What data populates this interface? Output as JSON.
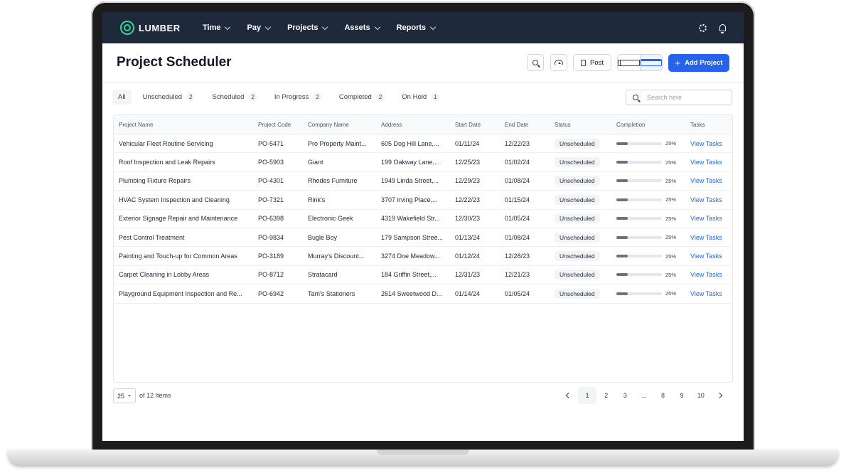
{
  "brand": {
    "name": "LUMBER",
    "accent": "#34d399"
  },
  "nav": {
    "items": [
      "Time",
      "Pay",
      "Projects",
      "Assets",
      "Reports"
    ]
  },
  "header": {
    "title": "Project Scheduler",
    "post_label": "Post",
    "add_label": "Add Project"
  },
  "tabs": [
    {
      "label": "All",
      "count": ""
    },
    {
      "label": "Unscheduled",
      "count": "2"
    },
    {
      "label": "Scheduled",
      "count": "2"
    },
    {
      "label": "In Progress",
      "count": "2"
    },
    {
      "label": "Completed",
      "count": "2"
    },
    {
      "label": "On Hold",
      "count": "1"
    }
  ],
  "search": {
    "placeholder": "Search here"
  },
  "table": {
    "columns": [
      "Project Name",
      "Project Code",
      "Company Name",
      "Address",
      "Start Date",
      "End Date",
      "Status",
      "Completion",
      "Tasks"
    ],
    "rows": [
      [
        "Vehicular Fleet Routine Servicing",
        "PO-5471",
        "Pro Property Maint...",
        "605 Dog Hill Lane,...",
        "01/11/24",
        "12/22/23",
        "Unscheduled",
        "25%",
        "View Tasks"
      ],
      [
        "Roof Inspection and Leak Repairs",
        "PO-5903",
        "Giant",
        "199 Oakway Lane,...",
        "12/25/23",
        "01/02/24",
        "Unscheduled",
        "25%",
        "View Tasks"
      ],
      [
        "Plumbing Fixture Repairs",
        "PO-4301",
        "Rhodes Furniture",
        "1949 Linda Street,...",
        "12/29/23",
        "01/08/24",
        "Unscheduled",
        "25%",
        "View Tasks"
      ],
      [
        "HVAC System Inspection and Cleaning",
        "PO-7321",
        "Rink's",
        "3707 Irving Place,...",
        "12/22/23",
        "01/15/24",
        "Unscheduled",
        "25%",
        "View Tasks"
      ],
      [
        "Exterior Signage Repair and Maintenance",
        "PO-6398",
        "Electronic Geek",
        "4319 Wakefield Str...",
        "12/30/23",
        "01/05/24",
        "Unscheduled",
        "25%",
        "View Tasks"
      ],
      [
        "Pest Control Treatment",
        "PO-9834",
        "Bugle Boy",
        "179 Sampson Stree...",
        "01/13/24",
        "01/08/24",
        "Unscheduled",
        "25%",
        "View Tasks"
      ],
      [
        "Painting and Touch-up for Common Areas",
        "PO-3189",
        "Murray's Discount...",
        "3274 Doe Meadow...",
        "01/12/24",
        "12/28/23",
        "Unscheduled",
        "25%",
        "View Tasks"
      ],
      [
        "Carpet Cleaning in Lobby Areas",
        "PO-8712",
        "Stratacard",
        "184 Griffin Street,...",
        "12/31/23",
        "12/21/23",
        "Unscheduled",
        "25%",
        "View Tasks"
      ],
      [
        "Playground Equipment Inspection and Re...",
        "PO-6942",
        "Tam's Stationers",
        "2614 Sweetwood D...",
        "01/14/24",
        "01/05/24",
        "Unscheduled",
        "25%",
        "View Tasks"
      ]
    ],
    "completion_fraction": 0.25
  },
  "pagination": {
    "page_size": "25",
    "items_text": "of 12 Items",
    "pages": [
      "1",
      "2",
      "3",
      "...",
      "8",
      "9",
      "10"
    ],
    "current": "1"
  }
}
